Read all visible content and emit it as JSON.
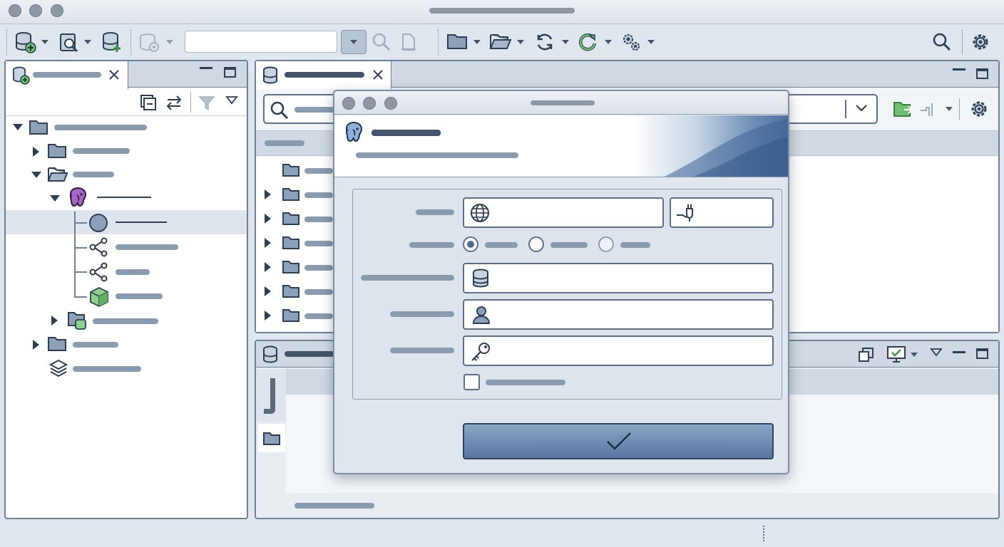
{
  "window": {
    "title": "",
    "controls": [
      "close",
      "minimize",
      "maximize"
    ]
  },
  "toolbar": {
    "search_value": "",
    "icons": [
      "new-connection-icon",
      "sql-editor-icon",
      "new-database-icon",
      "database-settings-icon",
      "search-icon",
      "copy-icon",
      "folder-icon",
      "open-folder-icon",
      "refresh-icon",
      "reconnect-icon",
      "settings-icon",
      "search-icon",
      "preferences-icon"
    ]
  },
  "navigator": {
    "tab_label": "",
    "tree": [
      {
        "label": "",
        "level": 0,
        "expanded": true,
        "icon": "folder-icon"
      },
      {
        "label": "",
        "level": 1,
        "expanded": false,
        "icon": "folder-icon"
      },
      {
        "label": "",
        "level": 1,
        "expanded": true,
        "icon": "open-folder-icon"
      },
      {
        "label": "",
        "level": 2,
        "expanded": true,
        "icon": "postgresql-elephant-icon"
      },
      {
        "label": "",
        "level": 3,
        "icon": "circle-icon",
        "selected": true
      },
      {
        "label": "",
        "level": 3,
        "icon": "schema-icon"
      },
      {
        "label": "",
        "level": 3,
        "icon": "schema-icon"
      },
      {
        "label": "",
        "level": 3,
        "icon": "cube-icon"
      },
      {
        "label": "",
        "level": 2,
        "expanded": false,
        "icon": "folder-db-icon"
      },
      {
        "label": "",
        "level": 1,
        "expanded": false,
        "icon": "folder-icon"
      },
      {
        "label": "",
        "level": 1,
        "icon": "layers-icon"
      }
    ]
  },
  "editor": {
    "tab_label": "",
    "search_placeholder": ""
  },
  "results_panel": {
    "tab_label": ""
  },
  "dialog": {
    "title": "",
    "header_title": "",
    "header_subtitle": "",
    "host_value": "",
    "port_value": "",
    "radio_options": [
      "",
      "",
      ""
    ],
    "radio_selected": 0,
    "database_value": "",
    "user_value": "",
    "password_value": "",
    "checkbox_label": "",
    "checkbox_checked": false,
    "confirm_icon": "check-icon",
    "accent_color": "#4f72a0"
  },
  "statusbar": {
    "text": ""
  }
}
